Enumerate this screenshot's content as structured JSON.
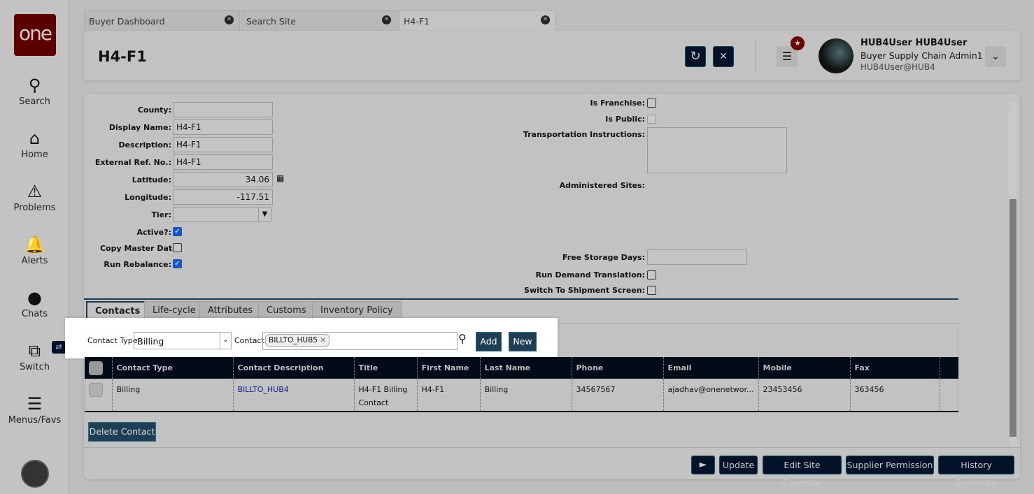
{
  "sidebar": {
    "logo": "one",
    "items": [
      {
        "label": "Search",
        "icon": "search-icon"
      },
      {
        "label": "Home",
        "icon": "home-icon"
      },
      {
        "label": "Problems",
        "icon": "warning-icon"
      },
      {
        "label": "Alerts",
        "icon": "bell-icon"
      },
      {
        "label": "Chats",
        "icon": "chat-icon"
      },
      {
        "label": "Switch",
        "icon": "switch-icon"
      },
      {
        "label": "Menus/Favs",
        "icon": "menu-icon"
      }
    ]
  },
  "tabs": [
    {
      "label": "Buyer Dashboard"
    },
    {
      "label": "Search Site"
    },
    {
      "label": "H4-F1"
    }
  ],
  "header": {
    "title": "H4-F1",
    "user_name": "HUB4User HUB4User",
    "user_role": "Buyer Supply Chain Admin1",
    "user_id": "HUB4User@HUB4"
  },
  "form_left": [
    {
      "label": "County:",
      "value": ""
    },
    {
      "label": "Display Name:",
      "value": "H4-F1"
    },
    {
      "label": "Description:",
      "value": "H4-F1"
    },
    {
      "label": "External Ref. No.:",
      "value": "H4-F1"
    },
    {
      "label": "Latitude:",
      "value": "34.06"
    },
    {
      "label": "Longitude:",
      "value": "-117.51"
    },
    {
      "label": "Tier:",
      "value": ""
    }
  ],
  "checks_left": [
    {
      "label": "Active?:",
      "checked": true
    },
    {
      "label": "Copy Master Data:",
      "checked": false
    },
    {
      "label": "Run Rebalance:",
      "checked": true
    }
  ],
  "form_right": {
    "is_franchise": "Is Franchise:",
    "is_public": "Is Public:",
    "transport": "Transportation Instructions:",
    "administered": "Administered Sites:",
    "free_storage": "Free Storage Days:",
    "run_demand": "Run Demand Translation:",
    "switch_shipment": "Switch To Shipment Screen:"
  },
  "subtabs": [
    "Contacts",
    "Life-cycle",
    "Attributes",
    "Customs",
    "Inventory Policy"
  ],
  "contact_bar": {
    "type_label": "Contact Type",
    "type_value": "Billing",
    "contact_label": "Contact",
    "contact_chip": "BILLTO_HUB5",
    "add": "Add",
    "new": "New"
  },
  "table": {
    "headers": [
      "Contact Type",
      "Contact Description",
      "Title",
      "First Name",
      "Last Name",
      "Phone",
      "Email",
      "Mobile",
      "Fax"
    ],
    "rows": [
      [
        "Billing",
        "BILLTO_HUB4",
        "H4-F1 Billing Contact",
        "H4-F1",
        "Billing",
        "34567567",
        "ajadhav@onenetwor...",
        "23453456",
        "363456"
      ]
    ]
  },
  "delete_contact": "Delete Contact",
  "footer": {
    "update": "Update",
    "edit_calendar": "Edit Site Calendar",
    "supplier_permission": "Supplier Permission",
    "history_similarity": "History Similarity"
  }
}
